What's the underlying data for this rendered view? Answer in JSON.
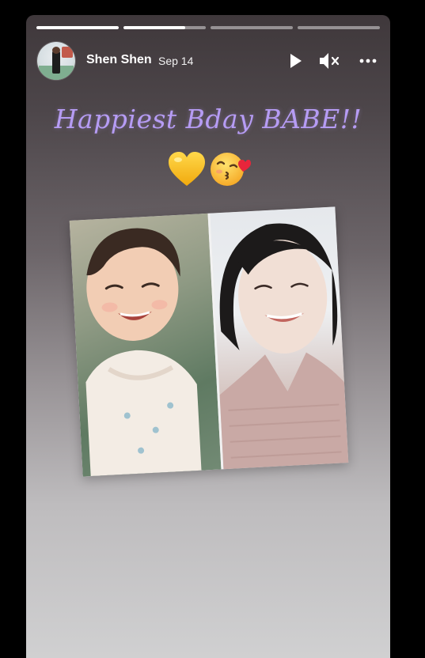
{
  "progress": [
    {
      "fill": 1.0
    },
    {
      "fill": 0.75
    },
    {
      "fill": 0.0
    },
    {
      "fill": 0.0
    }
  ],
  "header": {
    "avatar_icon": "profile-photo",
    "user_name": "Shen Shen",
    "date": "Sep 14",
    "play_icon": "play-icon",
    "mute_icon": "volume-muted-icon",
    "more_icon": "more-options-icon"
  },
  "story": {
    "headline": "Happiest Bday BABE!!",
    "headline_color": "#b69cf4",
    "emojis": [
      "yellow-heart-emoji",
      "kissing-face-emoji"
    ],
    "photo": {
      "left_description_icon": "child-smiling-photo",
      "right_description_icon": "adult-smiling-photo"
    }
  },
  "colors": {
    "background": "#000000",
    "story_top": "#3f383b",
    "story_bottom": "#d0d0d1",
    "progress_active": "#ffffff"
  }
}
